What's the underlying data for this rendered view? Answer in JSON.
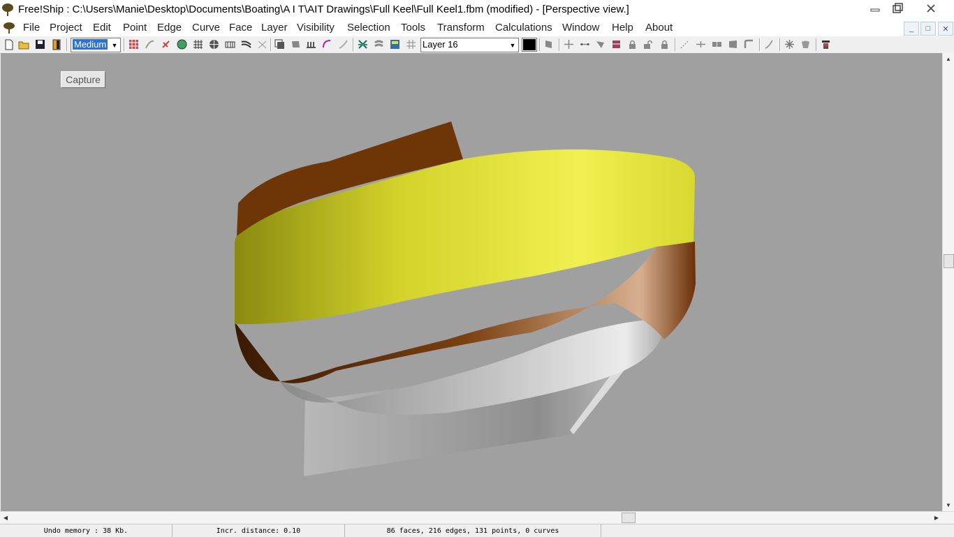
{
  "title": "Free!Ship  : C:\\Users\\Manie\\Desktop\\Documents\\Boating\\A I T\\AIT Drawings\\Full Keel\\Full Keel1.fbm (modified) - [Perspective view.]",
  "menu": [
    "File",
    "Project",
    "Edit",
    "Point",
    "Edge",
    "Curve",
    "Face",
    "Layer",
    "Visibility",
    "Selection",
    "Tools",
    "Transform",
    "Calculations",
    "Window",
    "Help",
    "About"
  ],
  "toolbar": {
    "precision_value": "Medium",
    "layer_value": "Layer 16",
    "layer_color": "#000000"
  },
  "viewport": {
    "capture_label": "Capture",
    "hull_colors": {
      "topsides": "#e8e830",
      "boot_stripe": "#7a4010",
      "bottom": "#c8c8c8",
      "background": "#a0a0a0"
    }
  },
  "status": {
    "undo": "Undo memory : 38 Kb.",
    "increment": "Incr. distance: 0.10",
    "summary": "86 faces, 216 edges, 131 points, 0 curves"
  }
}
